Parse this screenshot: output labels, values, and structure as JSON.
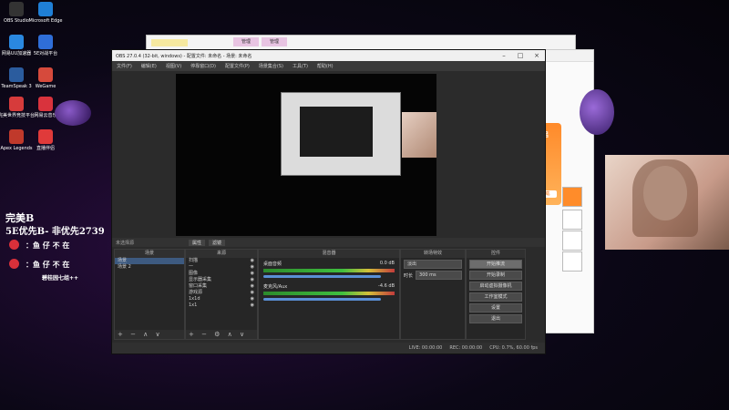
{
  "desktop_icons": [
    {
      "label": "OBS Studio",
      "color": "#333"
    },
    {
      "label": "Microsoft Edge",
      "color": "#1f7fd6"
    },
    {
      "label": "网易UU加速器",
      "color": "#2a88e0"
    },
    {
      "label": "5E对战平台",
      "color": "#2f6ed8"
    },
    {
      "label": "TeamSpeak 3",
      "color": "#2b5c9e"
    },
    {
      "label": "WeGame",
      "color": "#d64a3c"
    },
    {
      "label": "完美世界竞技平台",
      "color": "#d63b3b"
    },
    {
      "label": "网易云音乐",
      "color": "#d9333d"
    },
    {
      "label": "Apex Legends",
      "color": "#c0392b"
    },
    {
      "label": "直播伴侣",
      "color": "#e03a3a"
    }
  ],
  "overlay": {
    "line1": "完美B",
    "line2": "5E优先B- 非优先2739",
    "weibo1": "：鱼 仔 不 在",
    "weibo2": "：鱼 仔 不 在",
    "line5": "碧桂园七组++"
  },
  "obs": {
    "title": "OBS 27.0.4 (32-bit, windows) - 配置文件: 未命名 - 场景: 未命名",
    "menu": [
      "文件(F)",
      "编辑(E)",
      "视图(V)",
      "停靠窗口(D)",
      "配置文件(P)",
      "场景集合(S)",
      "工具(T)",
      "帮助(H)"
    ],
    "source_bar": {
      "no_source": "未选择源",
      "properties": "属性",
      "filters": "滤镜"
    },
    "docks": {
      "scenes": {
        "title": "场景",
        "items": [
          "场景",
          "场景 2"
        ],
        "toolbar": "+ − ∧ ∨"
      },
      "sources": {
        "title": "来源",
        "items": [
          "扫描",
          "一",
          "图像",
          "显示器采集",
          "窗口采集",
          "游戏源",
          "1x1d",
          "1x1"
        ],
        "toolbar": "+ − ⚙ ∧ ∨"
      },
      "mixer": {
        "title": "混音器",
        "channels": [
          {
            "name": "桌面音频",
            "db": "0.0 dB"
          },
          {
            "name": "麦克风/Aux",
            "db": "-4.6 dB"
          }
        ]
      },
      "transitions": {
        "title": "转场特效",
        "type": "淡出",
        "duration_label": "时长",
        "duration": "300 ms"
      },
      "controls": {
        "title": "控件",
        "buttons": [
          "开始推流",
          "开始录制",
          "启动虚拟摄像机",
          "工作室模式",
          "设置",
          "退出"
        ]
      }
    },
    "status": {
      "live": "LIVE: 00:00:00",
      "rec": "REC: 00:00:00",
      "cpu": "CPU: 0.7%, 60.00 fps"
    }
  },
  "bg_window": {
    "tab1": "管理",
    "tab2": "管理"
  },
  "rwin": {
    "text": "直播伴侣",
    "link": "免费下载"
  }
}
